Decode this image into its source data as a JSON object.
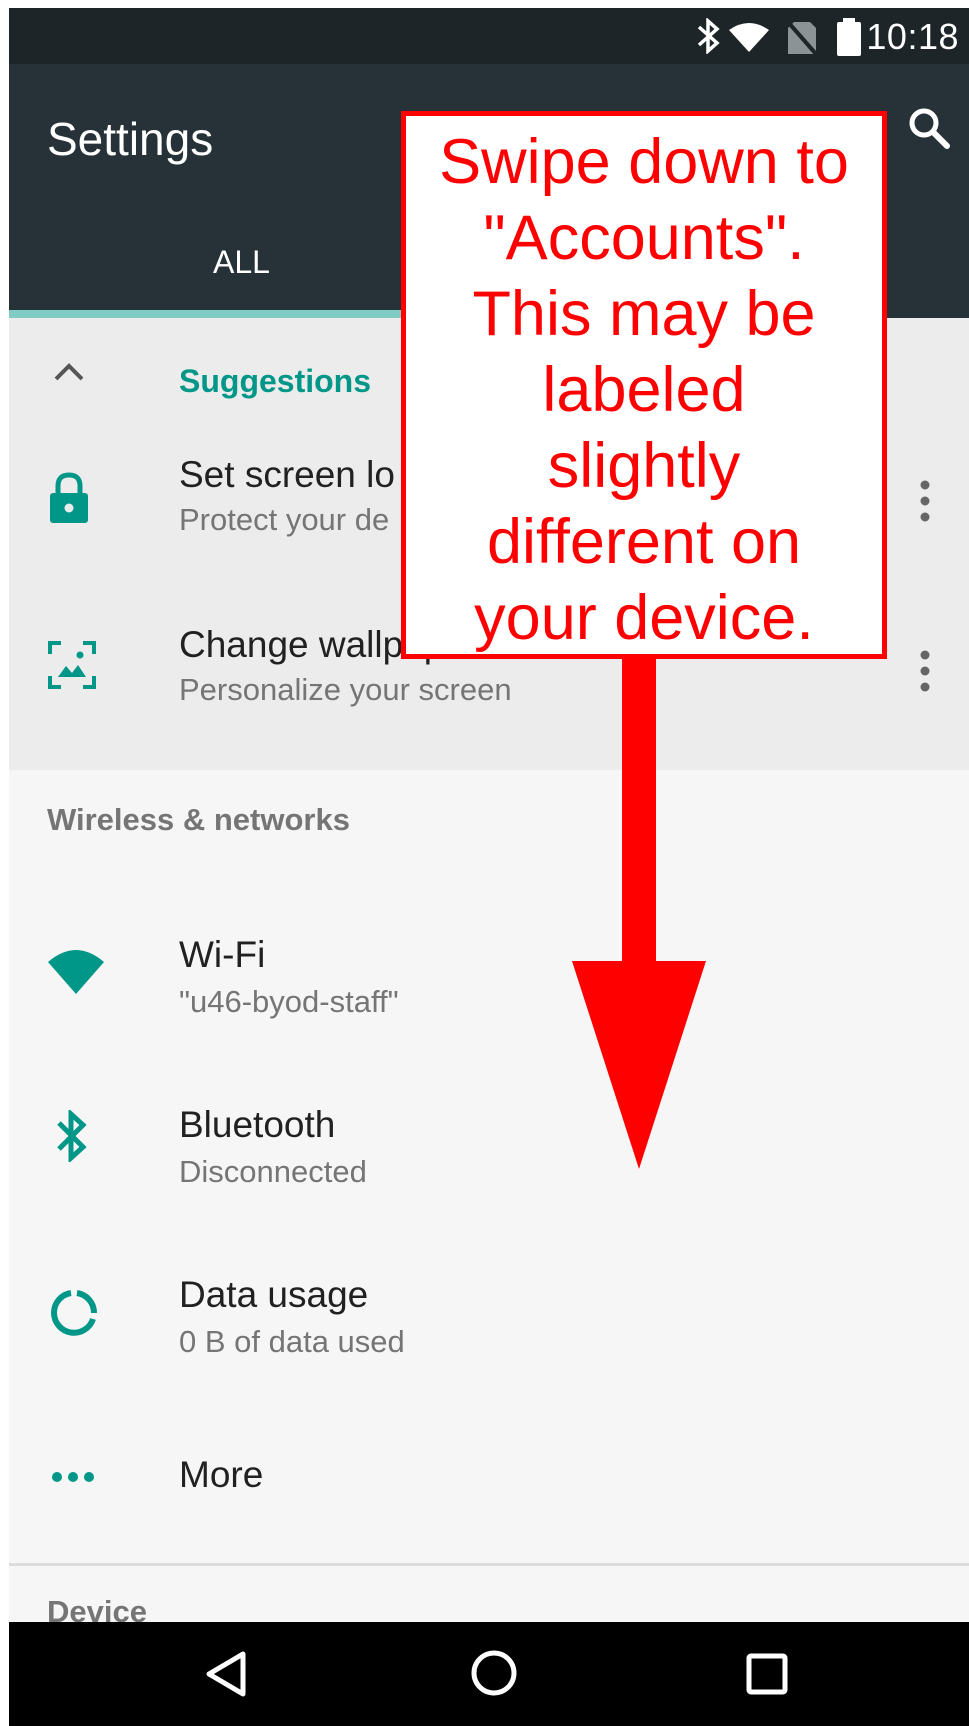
{
  "status_bar": {
    "time": "10:18",
    "icons": [
      "bluetooth-icon",
      "wifi-icon",
      "no-sim-icon",
      "battery-icon"
    ]
  },
  "app_bar": {
    "title": "Settings",
    "tabs": [
      "ALL"
    ],
    "search_icon": "search-icon"
  },
  "suggestions": {
    "header": "Suggestions",
    "items": [
      {
        "title": "Set screen lo",
        "subtitle": "Protect your de",
        "icon": "lock-icon"
      },
      {
        "title": "Change wallpaper",
        "subtitle": "Personalize your screen",
        "icon": "wallpaper-icon"
      }
    ]
  },
  "wireless": {
    "header": "Wireless & networks",
    "items": [
      {
        "title": "Wi-Fi",
        "subtitle": "\"u46-byod-staff\"",
        "icon": "wifi-icon"
      },
      {
        "title": "Bluetooth",
        "subtitle": "Disconnected",
        "icon": "bluetooth-icon"
      },
      {
        "title": "Data usage",
        "subtitle": "0 B of data used",
        "icon": "data-usage-icon"
      },
      {
        "title": "More",
        "icon": "more-dots-icon"
      }
    ]
  },
  "device": {
    "header": "Device"
  },
  "annotation": {
    "lines": [
      "Swipe down to",
      "\"Accounts\".",
      "This may be",
      "labeled",
      "slightly",
      "different on",
      "your device."
    ]
  },
  "colors": {
    "accent": "#009688",
    "toolbar": "#263238",
    "annotation": "#ff0000"
  }
}
